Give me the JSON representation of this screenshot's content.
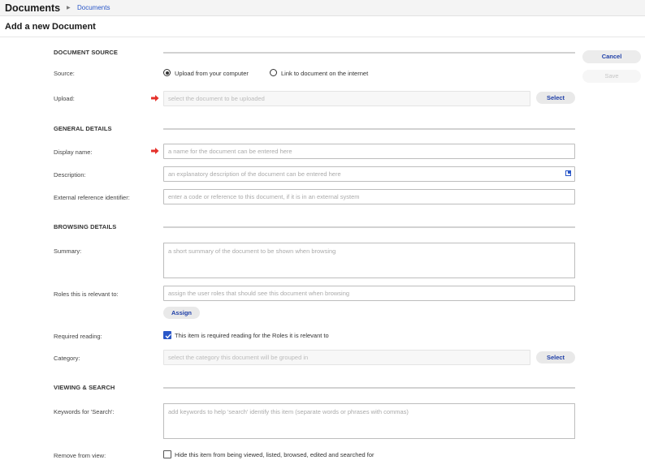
{
  "header": {
    "title": "Documents",
    "breadcrumb": "Documents"
  },
  "page_title": "Add a new Document",
  "actions": {
    "cancel": "Cancel",
    "save": "Save"
  },
  "sections": {
    "source": {
      "title": "DOCUMENT SOURCE",
      "source_label": "Source:",
      "option_upload": "Upload from your computer",
      "option_link": "Link to document on the internet",
      "selected": "Upload from your computer",
      "upload_label": "Upload:",
      "upload_placeholder": "select the document to be uploaded",
      "select_button": "Select"
    },
    "general": {
      "title": "GENERAL DETAILS",
      "display_name_label": "Display name:",
      "display_name_placeholder": "a name for the document can be entered here",
      "description_label": "Description:",
      "description_placeholder": "an explanatory description of the document can be entered here",
      "ext_ref_label": "External reference identifier:",
      "ext_ref_placeholder": "enter a code or reference to this document, if it is in an external system"
    },
    "browsing": {
      "title": "BROWSING DETAILS",
      "summary_label": "Summary:",
      "summary_placeholder": "a short summary of the document to be shown when browsing",
      "roles_label": "Roles this is relevant to:",
      "roles_placeholder": "assign the user roles that should see this document when browsing",
      "assign_button": "Assign",
      "required_label": "Required reading:",
      "required_text": "This item is required reading for the Roles it is relevant to",
      "required_checked": true,
      "category_label": "Category:",
      "category_placeholder": "select the category this document will be grouped in",
      "category_button": "Select"
    },
    "viewing": {
      "title": "VIEWING & SEARCH",
      "keywords_label": "Keywords for 'Search':",
      "keywords_placeholder": "add keywords to help 'search' identify this item (separate words or phrases with commas)",
      "remove_label": "Remove from view:",
      "remove_text": "Hide this item from being viewed, listed, browsed, edited and searched for",
      "remove_checked": false
    }
  },
  "icons": {
    "required_marker": "red-arrow-icon",
    "expand": "expand-icon"
  },
  "colors": {
    "accent": "#2a57c8",
    "required": "#e5302a"
  }
}
